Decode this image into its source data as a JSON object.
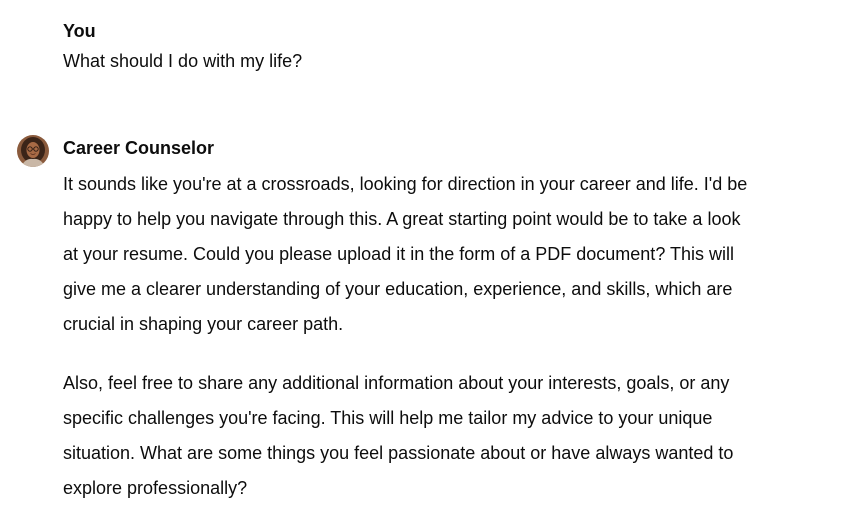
{
  "user_message": {
    "author": "You",
    "text": "What should I do with my life?"
  },
  "assistant_message": {
    "author": "Career Counselor",
    "avatar_icon": "counselor-avatar-photo",
    "paragraphs": [
      {
        "lines": [
          "It sounds like you're at a crossroads, looking for direction in your career and life. I'd be",
          "happy to help you navigate through this. A great starting point would be to take a look",
          "at your resume. Could you please upload it in the form of a PDF document? This will",
          "give me a clearer understanding of your education, experience, and skills, which are",
          "crucial in shaping your career path."
        ]
      },
      {
        "lines": [
          "Also, feel free to share any additional information about your interests, goals, or any",
          "specific challenges you're facing. This will help me tailor my advice to your unique",
          "situation. What are some things you feel passionate about or have always wanted to",
          "explore professionally?"
        ]
      }
    ]
  }
}
